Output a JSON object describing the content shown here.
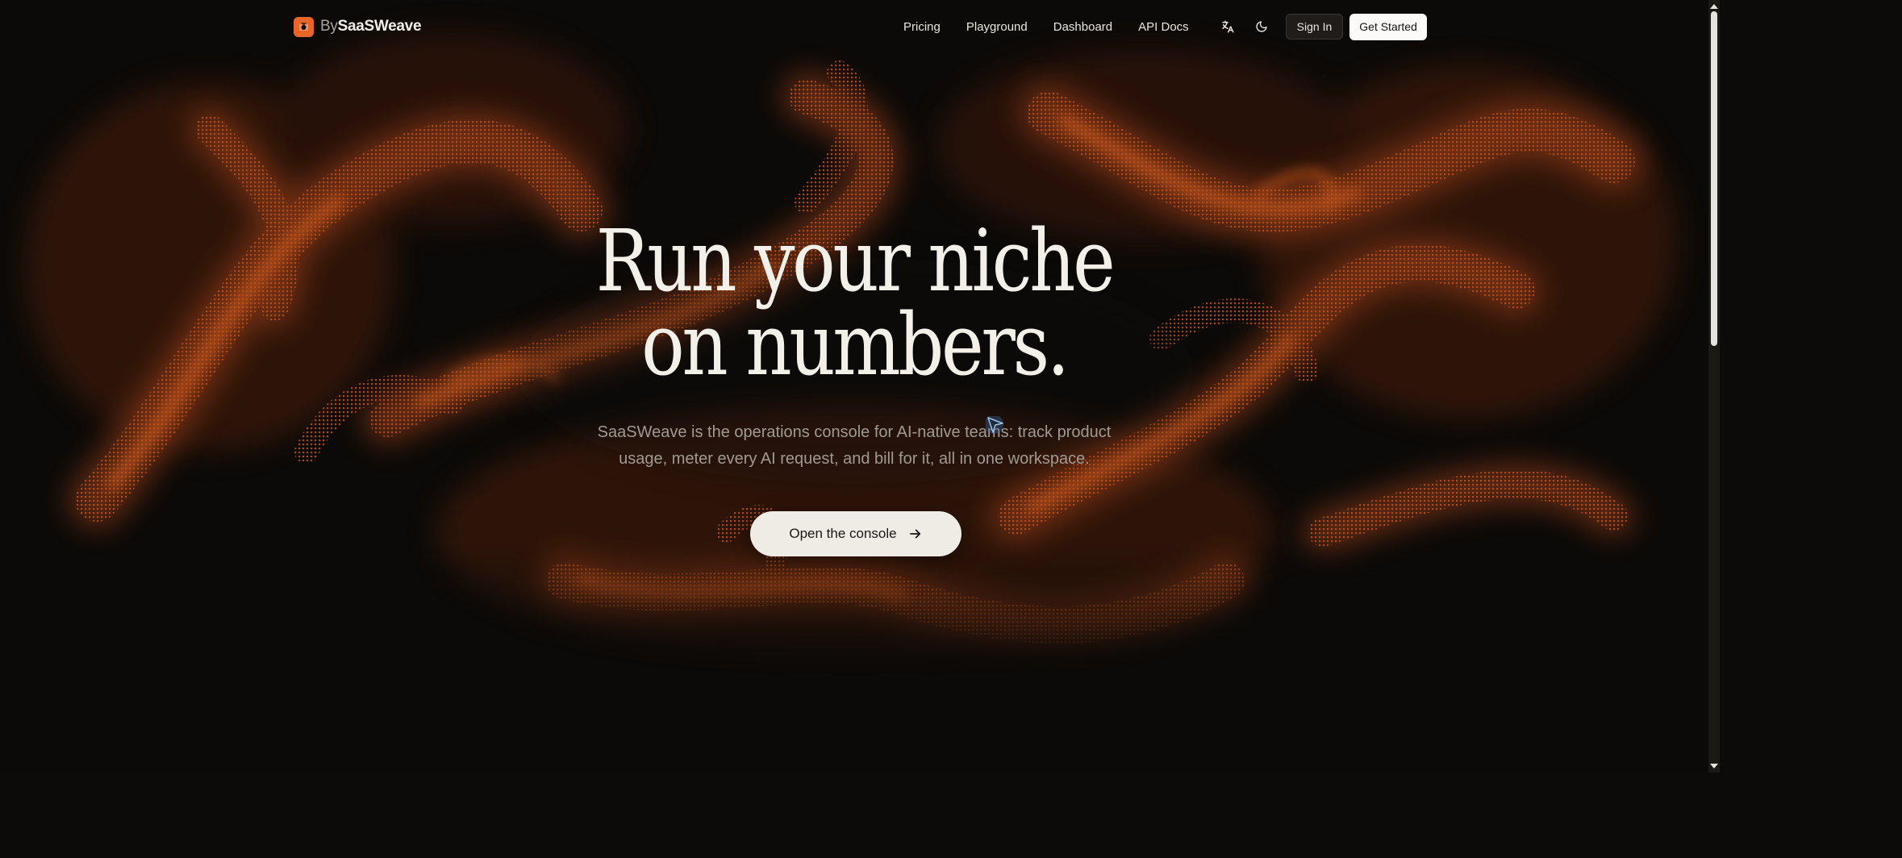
{
  "brand": {
    "prefix": "By",
    "name": "SaaSWeave",
    "color": "#e8652a"
  },
  "nav": {
    "links": [
      "Pricing",
      "Playground",
      "Dashboard",
      "API Docs"
    ],
    "translate_icon": "translate-icon",
    "theme_icon": "moon-icon",
    "sign_in_label": "Sign In",
    "get_started_label": "Get Started"
  },
  "hero": {
    "title_line1": "Run your niche",
    "title_line2": "on numbers.",
    "subtitle": "SaaSWeave is the operations console for AI-native teams: track product usage, meter every AI request, and bill for it, all in one workspace.",
    "cta_label": "Open the console",
    "cta_icon": "arrow-right-icon"
  },
  "colors": {
    "background": "#0c0a08",
    "accent": "#c2521b",
    "text": "#f3efe9"
  }
}
